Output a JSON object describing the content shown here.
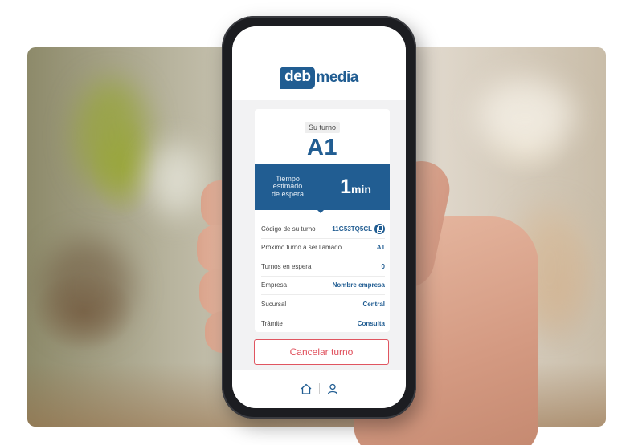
{
  "app": {
    "logo_box": "deb",
    "logo_rest": "media"
  },
  "turn": {
    "label": "Su turno",
    "code": "A1"
  },
  "wait": {
    "caption_line1": "Tiempo",
    "caption_line2": "estimado",
    "caption_line3": "de espera",
    "number": "1",
    "unit": "min"
  },
  "details": [
    {
      "label": "Código de su turno",
      "value": "11G53TQ5CL"
    },
    {
      "label": "Próximo turno a ser llamado",
      "value": "A1"
    },
    {
      "label": "Turnos en espera",
      "value": "0"
    },
    {
      "label": "Empresa",
      "value": "Nombre empresa"
    },
    {
      "label": "Sucursal",
      "value": "Central"
    },
    {
      "label": "Trámite",
      "value": "Consulta"
    }
  ],
  "actions": {
    "cancel_label": "Cancelar turno"
  },
  "icons": {
    "copy": "copy-icon",
    "home": "home-icon",
    "profile": "user-icon"
  },
  "colors": {
    "brand_blue": "#215d92",
    "cancel_red": "#e0505c"
  }
}
